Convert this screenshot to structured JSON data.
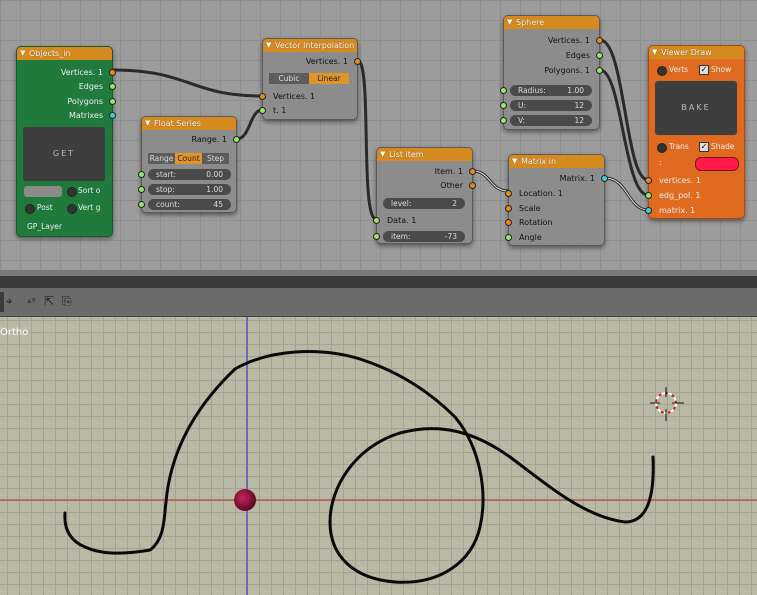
{
  "nodes": {
    "objects_in": {
      "title": "Objects_in",
      "outputs": [
        "Vertices. 1",
        "Edges",
        "Polygons",
        "Matrixes"
      ],
      "get_label": "GET",
      "sort_label": "Sort o",
      "post_label": "Post",
      "vert_label": "Vert g",
      "layer_label": "GP_Layer"
    },
    "float_series": {
      "title": "Float Series",
      "output": "Range. 1",
      "modes": [
        "Range",
        "Count",
        "Step"
      ],
      "active_mode": "Count",
      "fields": [
        {
          "label": "start:",
          "value": "0.00"
        },
        {
          "label": "stop:",
          "value": "1.00"
        },
        {
          "label": "count:",
          "value": "45"
        }
      ]
    },
    "vector_interpolation": {
      "title": "Vector Interpolation",
      "output": "Vertices. 1",
      "modes": [
        "Cubic",
        "Linear"
      ],
      "active_mode": "Linear",
      "inputs": [
        "Vertices. 1",
        "t. 1"
      ]
    },
    "sphere": {
      "title": "Sphere",
      "outputs": [
        "Vertices. 1",
        "Edges",
        "Polygons. 1"
      ],
      "fields": [
        {
          "label": "Radius:",
          "value": "1.00"
        },
        {
          "label": "U:",
          "value": "12"
        },
        {
          "label": "V:",
          "value": "12"
        }
      ]
    },
    "list_item": {
      "title": "List item",
      "outputs": [
        "Item. 1",
        "Other"
      ],
      "fields": [
        {
          "label": "level:",
          "value": "2"
        }
      ],
      "inputs": [
        "Data. 1"
      ],
      "item_field": {
        "label": "item:",
        "value": "-73"
      }
    },
    "matrix_in": {
      "title": "Matrix in",
      "output": "Matrix. 1",
      "inputs": [
        "Location. 1",
        "Scale",
        "Rotation",
        "Angle"
      ]
    },
    "viewer_draw": {
      "title": "Viewer Draw",
      "verts_label": "Verts",
      "show_label": "Show",
      "bake_label": "BAKE",
      "trans_label": "Trans",
      "shade_label": "Shade",
      "color_prefix": ":",
      "color": "#ff1a4a",
      "inputs": [
        "vertices. 1",
        "edg_pol. 1",
        "matrix. 1"
      ]
    }
  },
  "viewport": {
    "projection_label": "Ortho"
  },
  "colors": {
    "node_header": "#d48a1f",
    "objects_in_body": "#1f7a3c",
    "viewer_body": "#e06a20",
    "x_axis": "#b03030",
    "y_axis": "#3030c0"
  },
  "icons": [
    "snap-icon",
    "render-icon",
    "copy-paste-icon"
  ]
}
